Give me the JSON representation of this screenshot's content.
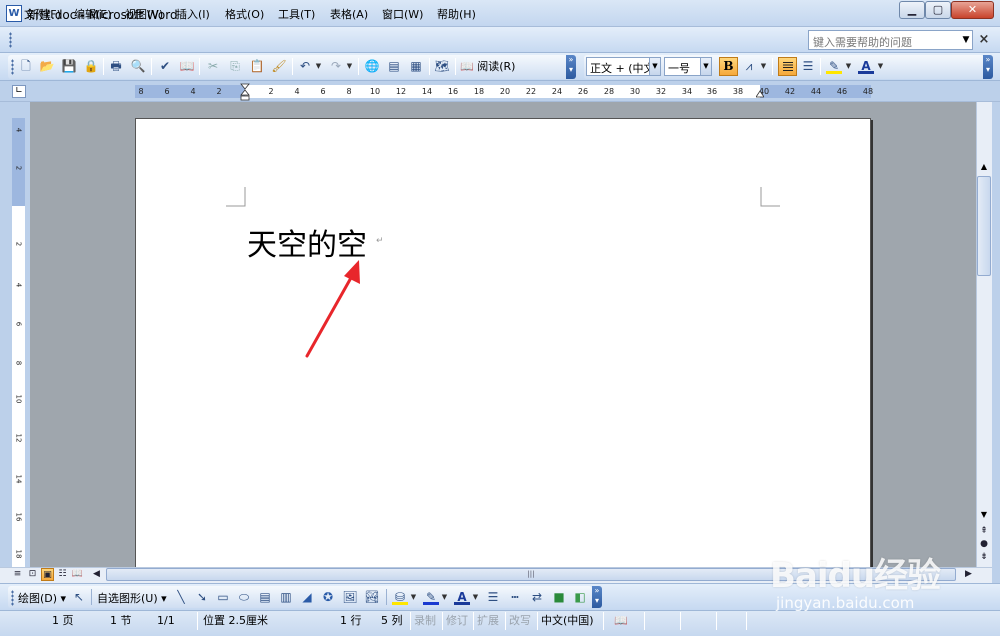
{
  "window": {
    "title": "新建.doc - Microsoft Word",
    "app_icon": "W"
  },
  "menu": {
    "items": [
      "文件(F)",
      "编辑(E)",
      "视图(V)",
      "插入(I)",
      "格式(O)",
      "工具(T)",
      "表格(A)",
      "窗口(W)",
      "帮助(H)"
    ],
    "help_placeholder": "键入需要帮助的问题"
  },
  "toolbar": {
    "read_label": "阅读(R)",
    "style_value": "正文 + (中文",
    "size_value": "一号",
    "bold_label": "B"
  },
  "ruler": {
    "ticks": [
      "8",
      "6",
      "4",
      "2",
      "2",
      "4",
      "6",
      "8",
      "10",
      "12",
      "14",
      "16",
      "18",
      "20",
      "22",
      "24",
      "26",
      "28",
      "30",
      "32",
      "34",
      "36",
      "38",
      "40",
      "42",
      "44",
      "46",
      "48"
    ],
    "vticks": [
      "4",
      "2",
      "2",
      "4",
      "6",
      "8",
      "10",
      "12",
      "14",
      "16",
      "18"
    ]
  },
  "document": {
    "text": "天空的空",
    "para_mark": "↵"
  },
  "draw_toolbar": {
    "draw_label": "绘图(D)",
    "autoshape_label": "自选图形(U)"
  },
  "status": {
    "page": "1 页",
    "section": "1 节",
    "page_of": "1/1",
    "position": "位置 2.5厘米",
    "line": "1 行",
    "col": "5 列",
    "rec": "录制",
    "trk": "修订",
    "ext": "扩展",
    "ovr": "改写",
    "lang": "中文(中国)"
  },
  "watermark": {
    "logo": "Baidu经验",
    "sub": "jingyan.baidu.com"
  },
  "colors": {
    "accent": "#f5a83b",
    "arrow": "#e8262b",
    "chrome": "#c6d9f1"
  }
}
